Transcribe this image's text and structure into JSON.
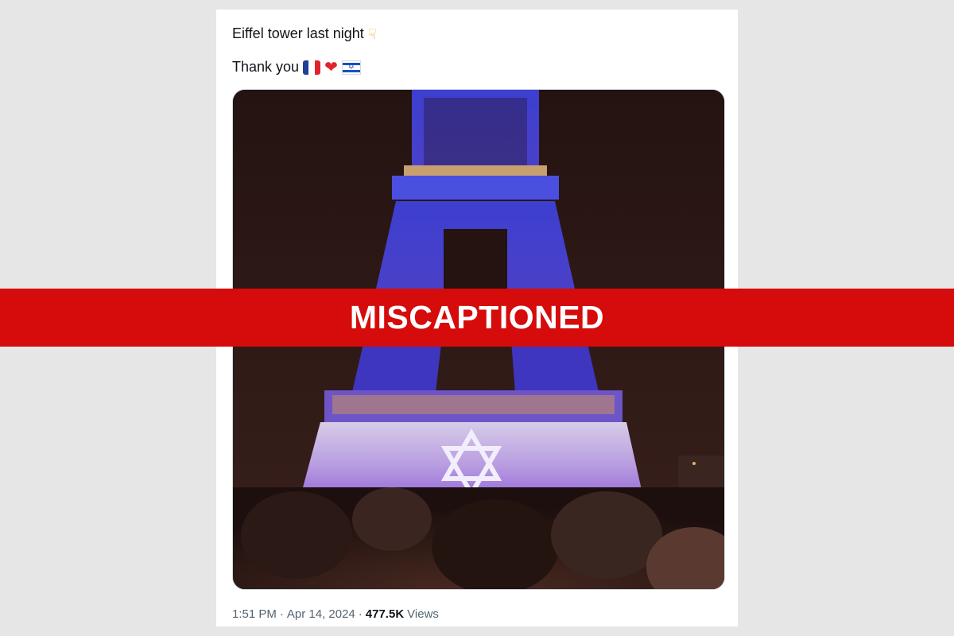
{
  "tweet": {
    "line1": "Eiffel tower last night",
    "line1_emoji": "backhand-index-pointing-down",
    "line2": "Thank you",
    "line2_emojis": [
      "flag-france",
      "red-heart",
      "flag-israel"
    ]
  },
  "photo": {
    "subject": "Eiffel Tower lit in blue and white with Star of David"
  },
  "meta": {
    "time": "1:51 PM",
    "sep1": "·",
    "date": "Apr 14, 2024",
    "sep2": "·",
    "views_count": "477.5K",
    "views_label": "Views"
  },
  "banner": {
    "label": "MISCAPTIONED",
    "color": "#d60b0b"
  },
  "colors": {
    "page_background": "#e6e6e6",
    "card_background": "#ffffff",
    "text": "#0f1419",
    "muted": "#536471"
  }
}
